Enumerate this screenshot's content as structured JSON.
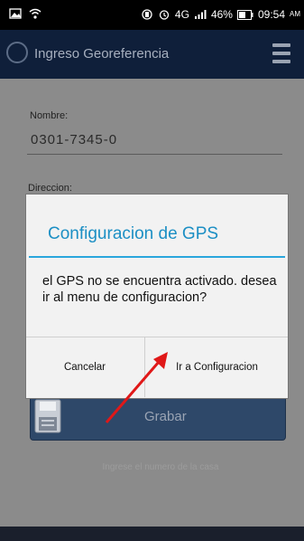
{
  "statusbar": {
    "battery_percent": "46%",
    "time": "09:54",
    "ampm": "AM",
    "network_label": "4G"
  },
  "actionbar": {
    "title": "Ingreso Georeferencia",
    "logo_icon": "app-logo-icon",
    "menu_icon": "hamburger-menu-icon"
  },
  "form": {
    "nombre_label": "Nombre:",
    "nombre_value": "0301-7345-0",
    "direccion_label": "Direccion:",
    "grabar_label": "Grabar",
    "faded_hint": "Ingrese el numero de la casa"
  },
  "dialog": {
    "title": "Configuracion de GPS",
    "message": "el GPS no se encuentra activado. desea ir al menu de configuracion?",
    "cancel_label": "Cancelar",
    "confirm_label": "Ir a Configuracion"
  },
  "colors": {
    "actionbar": "#0f1f3a",
    "dialog_accent": "#2aa6dc",
    "arrow": "#e01818"
  }
}
